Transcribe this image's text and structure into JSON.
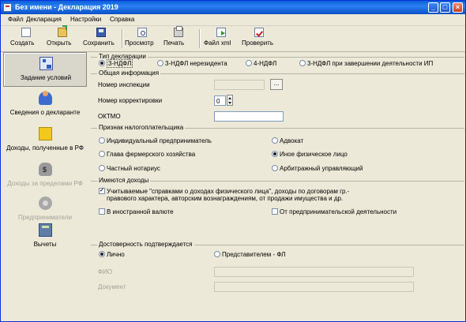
{
  "window": {
    "title": "Без имени - Декларация 2019"
  },
  "menu": [
    "Файл",
    "Декларация",
    "Настройки",
    "Справка"
  ],
  "toolbar": [
    {
      "label": "Создать",
      "icon": "new-doc-icon"
    },
    {
      "label": "Открыть",
      "icon": "open-folder-icon"
    },
    {
      "label": "Сохранить",
      "icon": "save-icon"
    },
    {
      "label": "Просмотр",
      "icon": "preview-icon"
    },
    {
      "label": "Печать",
      "icon": "print-icon"
    },
    {
      "label": "Файл xml",
      "icon": "xml-file-icon"
    },
    {
      "label": "Проверить",
      "icon": "check-icon"
    }
  ],
  "nav": [
    {
      "label": "Задание условий",
      "icon": "tree-icon",
      "active": true,
      "enabled": true
    },
    {
      "label": "Сведения о декларанте",
      "icon": "person-icon",
      "active": false,
      "enabled": true
    },
    {
      "label": "Доходы, полученные в РФ",
      "icon": "folder-icon",
      "active": false,
      "enabled": true
    },
    {
      "label": "Доходы за пределами РФ",
      "icon": "money-bag-icon",
      "active": false,
      "enabled": false
    },
    {
      "label": "Предприниматели",
      "icon": "gear-icon",
      "active": false,
      "enabled": false
    },
    {
      "label": "Вычеты",
      "icon": "calculator-icon",
      "active": false,
      "enabled": true
    }
  ],
  "decl_type": {
    "title": "Тип декларации",
    "options": [
      "3-НДФЛ",
      "3-НДФЛ нерезидента",
      "4-НДФЛ",
      "3-НДФЛ при завершении деятельности ИП"
    ],
    "selected": "3-НДФЛ"
  },
  "general": {
    "title": "Общая информация",
    "inspection_label": "Номер инспекции",
    "inspection_value": "",
    "browse_label": "...",
    "correction_label": "Номер корректировки",
    "correction_value": "0",
    "oktmo_label": "ОКТМО",
    "oktmo_value": ""
  },
  "taxpayer": {
    "title": "Признак налогоплательщика",
    "options": [
      "Индивидуальный предприниматель",
      "Адвокат",
      "Глава фермерского хозяйства",
      "Иное физическое лицо",
      "Частный нотариус",
      "Арбитражный управляющий"
    ],
    "selected": "Иное физическое лицо"
  },
  "income": {
    "title": "Имеются доходы",
    "items": [
      {
        "label": "Учитываемые \"справками о доходах физического лица\", доходы по договорам гр.-правового характера, авторским вознаграждениям, от продажи имущества и др.",
        "checked": true
      },
      {
        "label": "В иностранной валюте",
        "checked": false
      },
      {
        "label": "От предпринимательской деятельности",
        "checked": false
      }
    ]
  },
  "reliability": {
    "title": "Достоверность подтверждается",
    "options": [
      "Лично",
      "Представителем - ФЛ"
    ],
    "selected": "Лично",
    "fio_label": "ФИО",
    "doc_label": "Документ"
  }
}
